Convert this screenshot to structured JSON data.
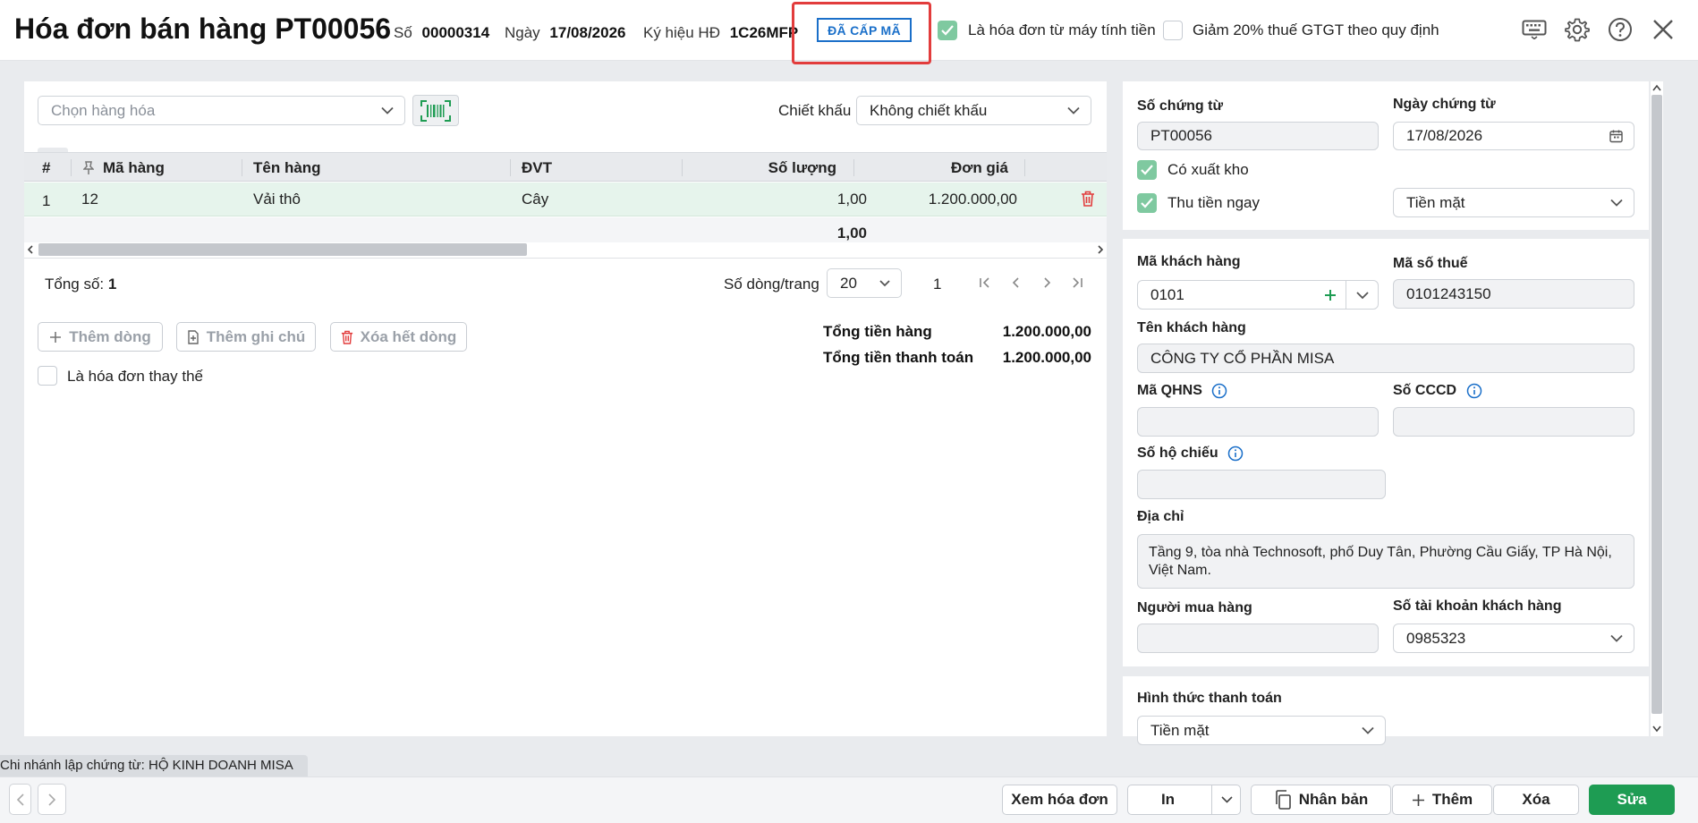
{
  "header": {
    "title": "Hóa đơn bán hàng PT00056",
    "so_label": "Số",
    "so_value": "00000314",
    "ngay_label": "Ngày",
    "ngay_value": "17/08/2026",
    "kyhieu_label": "Ký hiệu HĐ",
    "kyhieu_value": "1C26MFP",
    "status_badge": "ĐÃ CẤP MÃ",
    "cash_register_label": "Là hóa đơn từ máy tính tiền",
    "cash_register_checked": true,
    "vat_reduce_label": "Giảm 20% thuế GTGT theo quy định",
    "vat_reduce_checked": false,
    "icons": [
      "keyboard-icon",
      "gear-icon",
      "help-icon",
      "close-icon"
    ]
  },
  "items_panel": {
    "product_placeholder": "Chọn hàng hóa",
    "discount_label": "Chiết khấu",
    "discount_value": "Không chiết khấu",
    "columns": [
      "#",
      "Mã hàng",
      "Tên hàng",
      "ĐVT",
      "Số lượng",
      "Đơn giá"
    ],
    "rows": [
      {
        "index": "1",
        "code": "12",
        "name": "Vải thô",
        "unit": "Cây",
        "qty": "1,00",
        "price": "1.200.000,00"
      }
    ],
    "qty_total": "1,00",
    "total_label": "Tổng số:",
    "total_count": "1",
    "page_size_label": "Số dòng/trang",
    "page_size": "20",
    "current_page": "1",
    "add_row": "Thêm dòng",
    "add_note": "Thêm ghi chú",
    "delete_rows": "Xóa hết dòng",
    "sum_goods_label": "Tổng tiền hàng",
    "sum_goods_value": "1.200.000,00",
    "sum_pay_label": "Tổng tiền thanh toán",
    "sum_pay_value": "1.200.000,00",
    "replacement_label": "Là hóa đơn thay thế",
    "replacement_checked": false
  },
  "voucher": {
    "so_chung_tu_label": "Số chứng từ",
    "so_chung_tu": "PT00056",
    "ngay_chung_tu_label": "Ngày chứng từ",
    "ngay_chung_tu": "17/08/2026",
    "xuat_kho_label": "Có xuất kho",
    "xuat_kho_checked": true,
    "thu_tien_label": "Thu tiền ngay",
    "thu_tien_checked": true,
    "payment_method": "Tiền mặt"
  },
  "customer": {
    "ma_kh_label": "Mã khách hàng",
    "ma_kh": "0101",
    "mst_label": "Mã số thuế",
    "mst": "0101243150",
    "ten_kh_label": "Tên khách hàng",
    "ten_kh": "CÔNG TY CỔ PHẦN MISA",
    "qhns_label": "Mã QHNS",
    "qhns": "",
    "cccd_label": "Số CCCD",
    "cccd": "",
    "ho_chieu_label": "Số hộ chiếu",
    "ho_chieu": "",
    "dia_chi_label": "Địa chỉ",
    "dia_chi_line1": "Tầng 9, tòa nhà Technosoft, phố Duy Tân, Phường Cầu Giấy, TP Hà Nội,",
    "dia_chi_line2": "Việt Nam.",
    "nguoi_mua_label": "Người mua hàng",
    "nguoi_mua": "",
    "stk_label": "Số tài khoản khách hàng",
    "stk": "0985323"
  },
  "payment": {
    "hinh_thuc_label": "Hình thức thanh toán",
    "hinh_thuc": "Tiền mặt"
  },
  "footer": {
    "branch": "Chi nhánh lập chứng từ: HỘ KINH DOANH MISA",
    "view_invoice": "Xem hóa đơn",
    "print": "In",
    "duplicate": "Nhân bản",
    "add": "Thêm",
    "delete": "Xóa",
    "edit": "Sửa"
  },
  "colors": {
    "accent_green": "#1e9c53",
    "badge_blue": "#1a6fc9",
    "highlight_red": "#e23c3c",
    "checkbox_green": "#7fc9a0"
  }
}
